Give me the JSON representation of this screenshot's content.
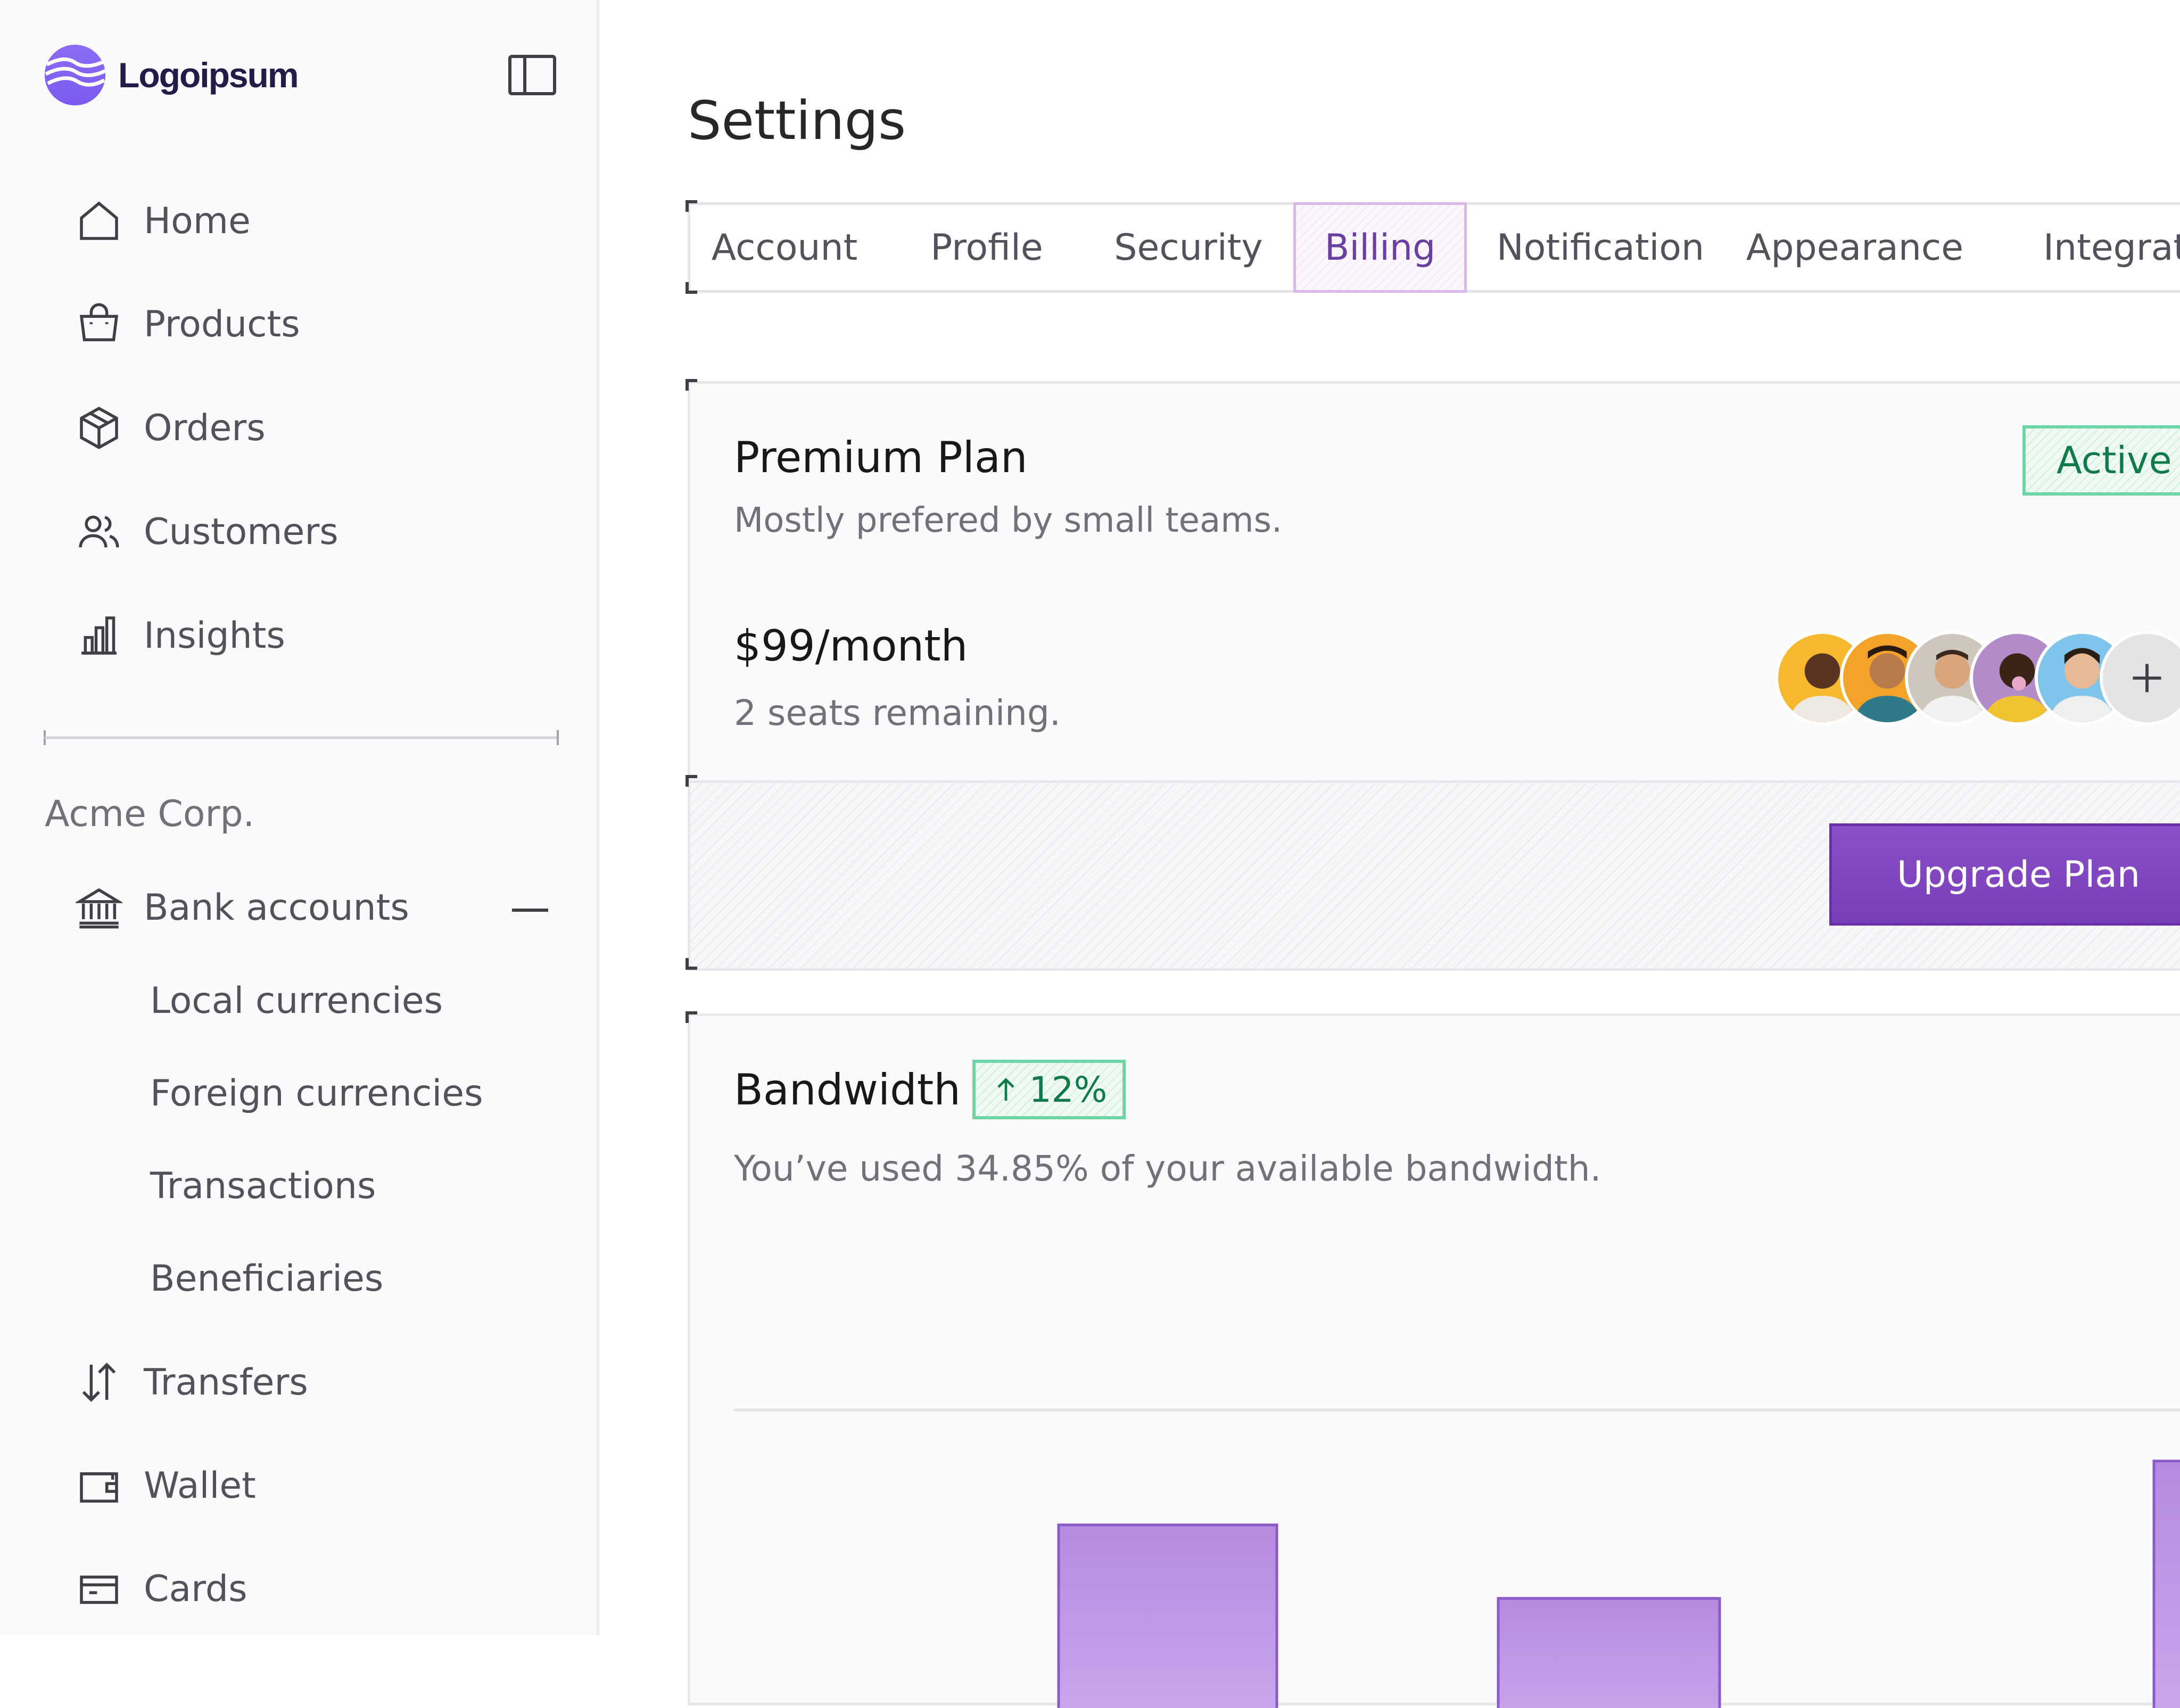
{
  "brand": {
    "name": "Logoipsum"
  },
  "nav": {
    "items": [
      {
        "label": "Home",
        "icon": "home-icon"
      },
      {
        "label": "Products",
        "icon": "shopping-bag-icon"
      },
      {
        "label": "Orders",
        "icon": "package-icon"
      },
      {
        "label": "Customers",
        "icon": "users-icon"
      },
      {
        "label": "Insights",
        "icon": "bar-chart-icon"
      }
    ],
    "group": {
      "title": "Acme Corp.",
      "bank": {
        "label": "Bank accounts",
        "icon": "bank-icon",
        "expanded": true
      },
      "sub_items": [
        "Local currencies",
        "Foreign currencies",
        "Transactions",
        "Beneficiaries"
      ],
      "items": [
        {
          "label": "Transfers",
          "icon": "arrows-updown-icon"
        },
        {
          "label": "Wallet",
          "icon": "wallet-icon"
        },
        {
          "label": "Cards",
          "icon": "card-icon"
        }
      ]
    }
  },
  "page": {
    "title": "Settings"
  },
  "tabs": {
    "items": [
      "Account",
      "Profile",
      "Security",
      "Billing",
      "Notification",
      "Appearance",
      "Integrat"
    ],
    "active": "Billing"
  },
  "plan": {
    "title": "Premium Plan",
    "description": "Mostly prefered by small teams.",
    "status": "Active",
    "price": "$99/month",
    "seats": "2 seats remaining.",
    "upgrade_label": "Upgrade Plan"
  },
  "bandwidth": {
    "title": "Bandwidth",
    "change": "12%",
    "description": "You’ve used 34.85% of your available bandwidth."
  },
  "colors": {
    "accent": "#7a3db8",
    "success": "#117a4a",
    "active_tab_border": "#d9b8ec"
  }
}
